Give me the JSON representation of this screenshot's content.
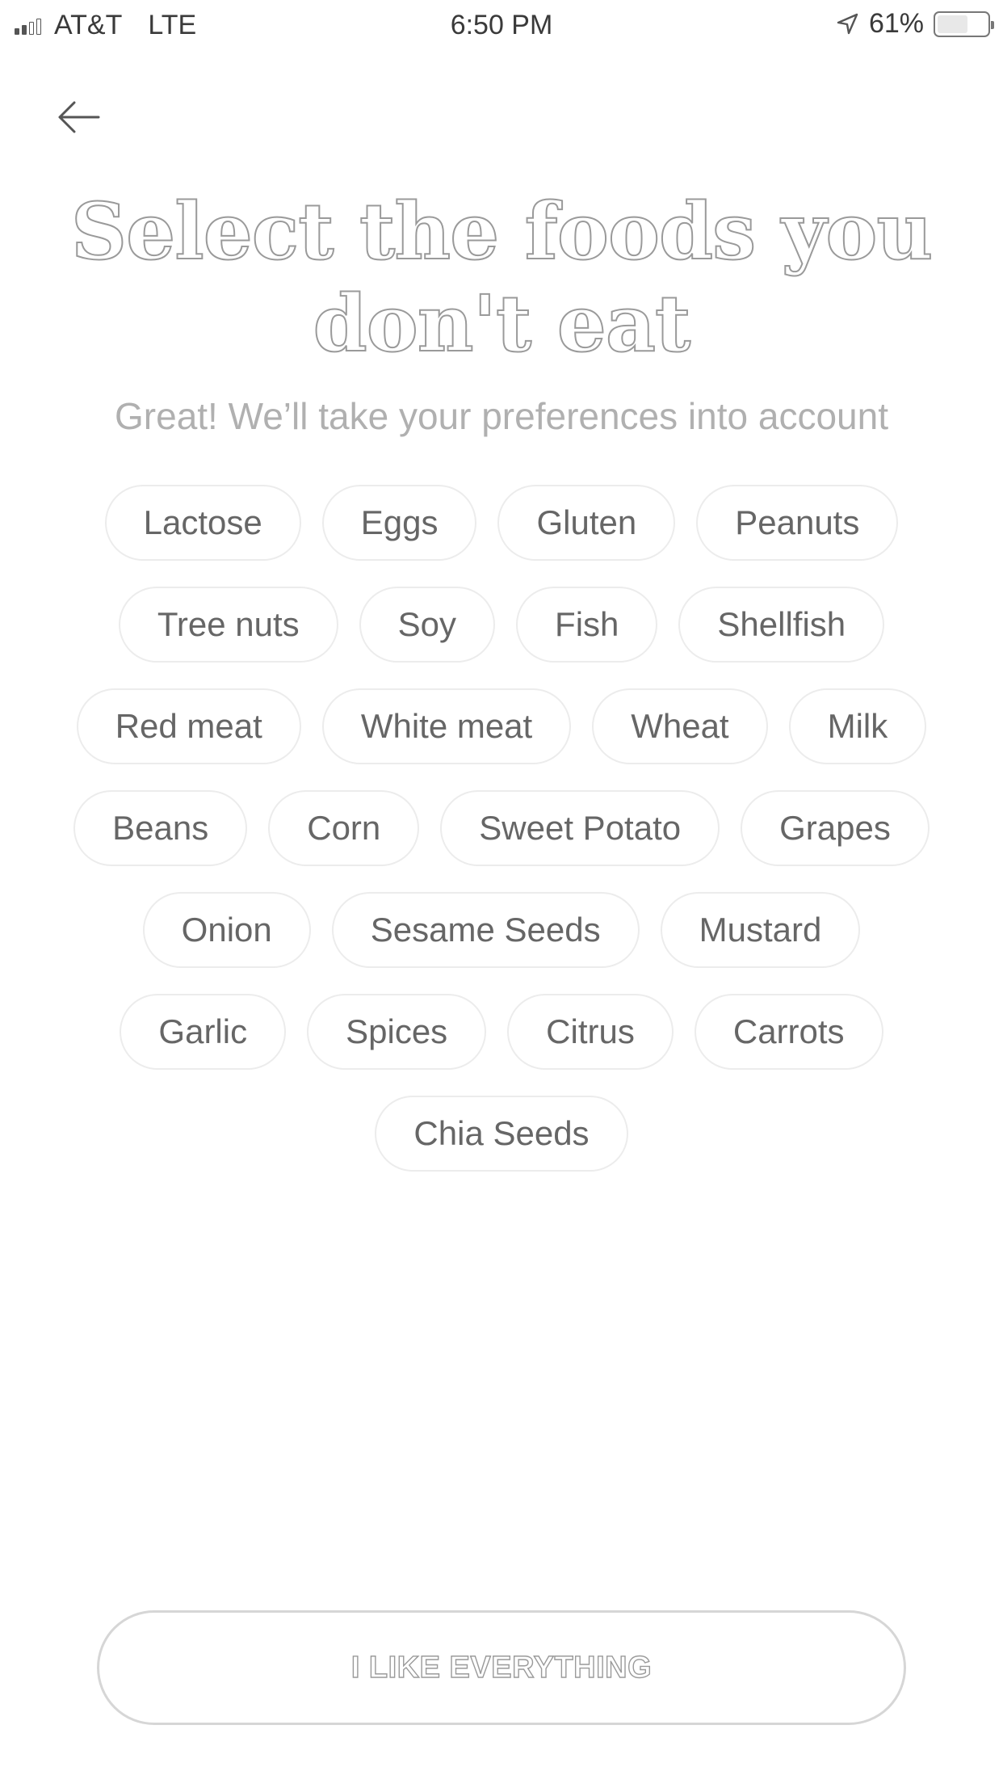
{
  "status_bar": {
    "carrier": "AT&T",
    "network": "LTE",
    "time": "6:50 PM",
    "battery_percent": "61%",
    "battery_level": 0.61,
    "signal_bars_filled": 2,
    "signal_bars_total": 4,
    "icons": [
      "signal-icon",
      "location-arrow-icon",
      "battery-icon"
    ]
  },
  "header": {
    "back_icon": "arrow-left-icon"
  },
  "title": {
    "line1": "Select the foods you",
    "line2": "don't eat"
  },
  "subtitle": "Great! We’ll take your preferences into account",
  "foods": [
    [
      "Lactose",
      "Eggs",
      "Gluten",
      "Peanuts"
    ],
    [
      "Tree nuts",
      "Soy",
      "Fish",
      "Shellfish"
    ],
    [
      "Red meat",
      "White meat",
      "Wheat",
      "Milk"
    ],
    [
      "Beans",
      "Corn",
      "Sweet Potato",
      "Grapes"
    ],
    [
      "Onion",
      "Sesame Seeds",
      "Mustard"
    ],
    [
      "Garlic",
      "Spices",
      "Citrus",
      "Carrots"
    ],
    [
      "Chia Seeds"
    ]
  ],
  "actions": {
    "like_everything_label": "I LIKE EVERYTHING"
  },
  "colors": {
    "background": "#ffffff",
    "chip_border": "#ececec",
    "chip_text": "#666666",
    "subtitle_text": "#b0b0b0",
    "title_outline": "#9a9a9a"
  }
}
